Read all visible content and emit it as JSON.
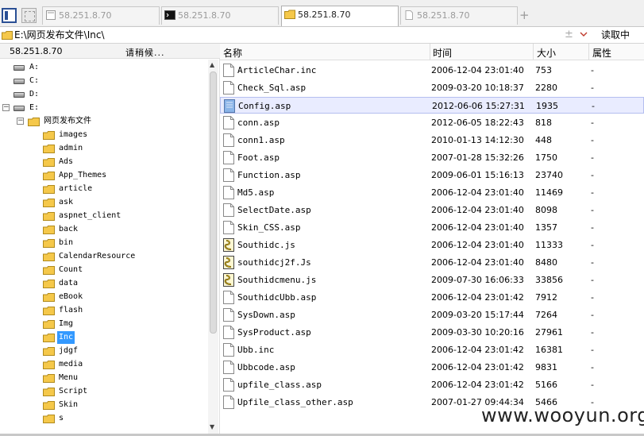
{
  "tabs": [
    {
      "label": "58.251.8.70",
      "icon": "file-tab-icon",
      "active": false
    },
    {
      "label": "58.251.8.70",
      "icon": "terminal-icon",
      "active": false
    },
    {
      "label": "58.251.8.70",
      "icon": "folder-icon",
      "active": true
    },
    {
      "label": "58.251.8.70",
      "icon": "document-tab-icon",
      "active": false
    }
  ],
  "new_tab_label": "+",
  "address": {
    "path": "E:\\网页发布文件\\Inc\\",
    "plus": "±",
    "read_button": "读取中"
  },
  "left_header": {
    "ip": "58.251.8.70",
    "status": "请稍候..."
  },
  "tree": {
    "drives": [
      {
        "label": "A:",
        "expander": ""
      },
      {
        "label": "C:",
        "expander": ""
      },
      {
        "label": "D:",
        "expander": ""
      },
      {
        "label": "E:",
        "expander": "−"
      }
    ],
    "root_folder": {
      "label": "网页发布文件",
      "expander": "−"
    },
    "folders": [
      "images",
      "admin",
      "Ads",
      "App_Themes",
      "article",
      "ask",
      "aspnet_client",
      "back",
      "bin",
      "CalendarResource",
      "Count",
      "data",
      "eBook",
      "flash",
      "Img",
      "Inc",
      "jdgf",
      "media",
      "Menu",
      "Script",
      "Skin",
      "s"
    ],
    "selected": "Inc"
  },
  "columns": {
    "name": "名称",
    "time": "时间",
    "size": "大小",
    "attr": "属性"
  },
  "files": [
    {
      "name": "ArticleChar.inc",
      "time": "2006-12-04 23:01:40",
      "size": "753",
      "attr": "-",
      "icon": "blank-file"
    },
    {
      "name": "Check_Sql.asp",
      "time": "2009-03-20 10:18:37",
      "size": "2280",
      "attr": "-",
      "icon": "blank-file"
    },
    {
      "name": "Config.asp",
      "time": "2012-06-06 15:27:31",
      "size": "1935",
      "attr": "-",
      "icon": "selected-file"
    },
    {
      "name": "conn.asp",
      "time": "2012-06-05 18:22:43",
      "size": "818",
      "attr": "-",
      "icon": "blank-file"
    },
    {
      "name": "conn1.asp",
      "time": "2010-01-13 14:12:30",
      "size": "448",
      "attr": "-",
      "icon": "blank-file"
    },
    {
      "name": "Foot.asp",
      "time": "2007-01-28 15:32:26",
      "size": "1750",
      "attr": "-",
      "icon": "blank-file"
    },
    {
      "name": "Function.asp",
      "time": "2009-06-01 15:16:13",
      "size": "23740",
      "attr": "-",
      "icon": "blank-file"
    },
    {
      "name": "Md5.asp",
      "time": "2006-12-04 23:01:40",
      "size": "11469",
      "attr": "-",
      "icon": "blank-file"
    },
    {
      "name": "SelectDate.asp",
      "time": "2006-12-04 23:01:40",
      "size": "8098",
      "attr": "-",
      "icon": "blank-file"
    },
    {
      "name": "Skin_CSS.asp",
      "time": "2006-12-04 23:01:40",
      "size": "1357",
      "attr": "-",
      "icon": "blank-file"
    },
    {
      "name": "Southidc.js",
      "time": "2006-12-04 23:01:40",
      "size": "11333",
      "attr": "-",
      "icon": "script-file"
    },
    {
      "name": "southidcj2f.Js",
      "time": "2006-12-04 23:01:40",
      "size": "8480",
      "attr": "-",
      "icon": "script-file"
    },
    {
      "name": "Southidcmenu.js",
      "time": "2009-07-30 16:06:33",
      "size": "33856",
      "attr": "-",
      "icon": "script-file"
    },
    {
      "name": "SouthidcUbb.asp",
      "time": "2006-12-04 23:01:42",
      "size": "7912",
      "attr": "-",
      "icon": "blank-file"
    },
    {
      "name": "SysDown.asp",
      "time": "2009-03-20 15:17:44",
      "size": "7264",
      "attr": "-",
      "icon": "blank-file"
    },
    {
      "name": "SysProduct.asp",
      "time": "2009-03-30 10:20:16",
      "size": "27961",
      "attr": "-",
      "icon": "blank-file"
    },
    {
      "name": "Ubb.inc",
      "time": "2006-12-04 23:01:42",
      "size": "16381",
      "attr": "-",
      "icon": "blank-file"
    },
    {
      "name": "Ubbcode.asp",
      "time": "2006-12-04 23:01:42",
      "size": "9831",
      "attr": "-",
      "icon": "blank-file"
    },
    {
      "name": "upfile_class.asp",
      "time": "2006-12-04 23:01:42",
      "size": "5166",
      "attr": "-",
      "icon": "blank-file"
    },
    {
      "name": "Upfile_class_other.asp",
      "time": "2007-01-27 09:44:34",
      "size": "5466",
      "attr": "-",
      "icon": "blank-file"
    }
  ],
  "selected_file": "Config.asp",
  "watermark": "www.wooyun.org",
  "colors": {
    "selection_blue": "#3399ff",
    "row_highlight": "#e9ecff",
    "folder_yellow": "#f5c84a"
  }
}
